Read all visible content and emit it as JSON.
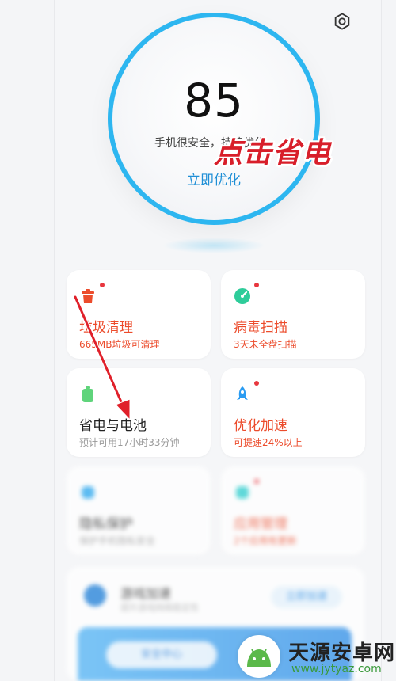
{
  "score": {
    "value": "85",
    "status": "手机很安全，持续优化",
    "action": "立即优化"
  },
  "annotation": "点击省电",
  "cards": [
    {
      "title": "垃圾清理",
      "subtitle": "665MB垃圾可清理",
      "icon": "trash-icon",
      "color": "#ec4c2c"
    },
    {
      "title": "病毒扫描",
      "subtitle": "3天未全盘扫描",
      "icon": "virus-scan-icon",
      "color": "#2ecc9a"
    },
    {
      "title": "省电与电池",
      "subtitle": "预计可用17小时33分钟",
      "icon": "battery-icon",
      "color": "#5fd47b"
    },
    {
      "title": "优化加速",
      "subtitle": "可提速24%以上",
      "icon": "rocket-icon",
      "color": "#2a9cf2"
    },
    {
      "title": "隐私保护",
      "subtitle": "保护手机隐私安全",
      "icon": "privacy-icon",
      "color": "#2aa8f0"
    },
    {
      "title": "应用管理",
      "subtitle": "2个应用有更新",
      "icon": "app-manager-icon",
      "color": "#2dcfcf"
    }
  ],
  "game": {
    "title": "游戏加速",
    "subtitle": "提升游戏网络稳定性",
    "button": "立即加速",
    "banner": "安全中心"
  },
  "watermark": {
    "name": "天源安卓网",
    "url": "www.jytyaz.com"
  },
  "colors": {
    "ring": "#2db6f0",
    "accent_text": "#1f8fd6",
    "alert": "#ec4c2c",
    "annotation": "#d81e2a"
  }
}
